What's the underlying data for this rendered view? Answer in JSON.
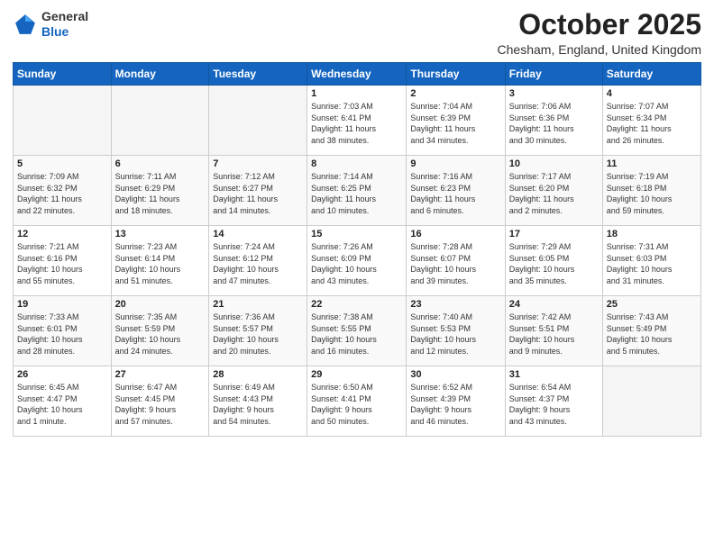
{
  "header": {
    "logo_line1": "General",
    "logo_line2": "Blue",
    "month": "October 2025",
    "location": "Chesham, England, United Kingdom"
  },
  "days_of_week": [
    "Sunday",
    "Monday",
    "Tuesday",
    "Wednesday",
    "Thursday",
    "Friday",
    "Saturday"
  ],
  "weeks": [
    [
      {
        "day": "",
        "info": ""
      },
      {
        "day": "",
        "info": ""
      },
      {
        "day": "",
        "info": ""
      },
      {
        "day": "1",
        "info": "Sunrise: 7:03 AM\nSunset: 6:41 PM\nDaylight: 11 hours\nand 38 minutes."
      },
      {
        "day": "2",
        "info": "Sunrise: 7:04 AM\nSunset: 6:39 PM\nDaylight: 11 hours\nand 34 minutes."
      },
      {
        "day": "3",
        "info": "Sunrise: 7:06 AM\nSunset: 6:36 PM\nDaylight: 11 hours\nand 30 minutes."
      },
      {
        "day": "4",
        "info": "Sunrise: 7:07 AM\nSunset: 6:34 PM\nDaylight: 11 hours\nand 26 minutes."
      }
    ],
    [
      {
        "day": "5",
        "info": "Sunrise: 7:09 AM\nSunset: 6:32 PM\nDaylight: 11 hours\nand 22 minutes."
      },
      {
        "day": "6",
        "info": "Sunrise: 7:11 AM\nSunset: 6:29 PM\nDaylight: 11 hours\nand 18 minutes."
      },
      {
        "day": "7",
        "info": "Sunrise: 7:12 AM\nSunset: 6:27 PM\nDaylight: 11 hours\nand 14 minutes."
      },
      {
        "day": "8",
        "info": "Sunrise: 7:14 AM\nSunset: 6:25 PM\nDaylight: 11 hours\nand 10 minutes."
      },
      {
        "day": "9",
        "info": "Sunrise: 7:16 AM\nSunset: 6:23 PM\nDaylight: 11 hours\nand 6 minutes."
      },
      {
        "day": "10",
        "info": "Sunrise: 7:17 AM\nSunset: 6:20 PM\nDaylight: 11 hours\nand 2 minutes."
      },
      {
        "day": "11",
        "info": "Sunrise: 7:19 AM\nSunset: 6:18 PM\nDaylight: 10 hours\nand 59 minutes."
      }
    ],
    [
      {
        "day": "12",
        "info": "Sunrise: 7:21 AM\nSunset: 6:16 PM\nDaylight: 10 hours\nand 55 minutes."
      },
      {
        "day": "13",
        "info": "Sunrise: 7:23 AM\nSunset: 6:14 PM\nDaylight: 10 hours\nand 51 minutes."
      },
      {
        "day": "14",
        "info": "Sunrise: 7:24 AM\nSunset: 6:12 PM\nDaylight: 10 hours\nand 47 minutes."
      },
      {
        "day": "15",
        "info": "Sunrise: 7:26 AM\nSunset: 6:09 PM\nDaylight: 10 hours\nand 43 minutes."
      },
      {
        "day": "16",
        "info": "Sunrise: 7:28 AM\nSunset: 6:07 PM\nDaylight: 10 hours\nand 39 minutes."
      },
      {
        "day": "17",
        "info": "Sunrise: 7:29 AM\nSunset: 6:05 PM\nDaylight: 10 hours\nand 35 minutes."
      },
      {
        "day": "18",
        "info": "Sunrise: 7:31 AM\nSunset: 6:03 PM\nDaylight: 10 hours\nand 31 minutes."
      }
    ],
    [
      {
        "day": "19",
        "info": "Sunrise: 7:33 AM\nSunset: 6:01 PM\nDaylight: 10 hours\nand 28 minutes."
      },
      {
        "day": "20",
        "info": "Sunrise: 7:35 AM\nSunset: 5:59 PM\nDaylight: 10 hours\nand 24 minutes."
      },
      {
        "day": "21",
        "info": "Sunrise: 7:36 AM\nSunset: 5:57 PM\nDaylight: 10 hours\nand 20 minutes."
      },
      {
        "day": "22",
        "info": "Sunrise: 7:38 AM\nSunset: 5:55 PM\nDaylight: 10 hours\nand 16 minutes."
      },
      {
        "day": "23",
        "info": "Sunrise: 7:40 AM\nSunset: 5:53 PM\nDaylight: 10 hours\nand 12 minutes."
      },
      {
        "day": "24",
        "info": "Sunrise: 7:42 AM\nSunset: 5:51 PM\nDaylight: 10 hours\nand 9 minutes."
      },
      {
        "day": "25",
        "info": "Sunrise: 7:43 AM\nSunset: 5:49 PM\nDaylight: 10 hours\nand 5 minutes."
      }
    ],
    [
      {
        "day": "26",
        "info": "Sunrise: 6:45 AM\nSunset: 4:47 PM\nDaylight: 10 hours\nand 1 minute."
      },
      {
        "day": "27",
        "info": "Sunrise: 6:47 AM\nSunset: 4:45 PM\nDaylight: 9 hours\nand 57 minutes."
      },
      {
        "day": "28",
        "info": "Sunrise: 6:49 AM\nSunset: 4:43 PM\nDaylight: 9 hours\nand 54 minutes."
      },
      {
        "day": "29",
        "info": "Sunrise: 6:50 AM\nSunset: 4:41 PM\nDaylight: 9 hours\nand 50 minutes."
      },
      {
        "day": "30",
        "info": "Sunrise: 6:52 AM\nSunset: 4:39 PM\nDaylight: 9 hours\nand 46 minutes."
      },
      {
        "day": "31",
        "info": "Sunrise: 6:54 AM\nSunset: 4:37 PM\nDaylight: 9 hours\nand 43 minutes."
      },
      {
        "day": "",
        "info": ""
      }
    ]
  ]
}
